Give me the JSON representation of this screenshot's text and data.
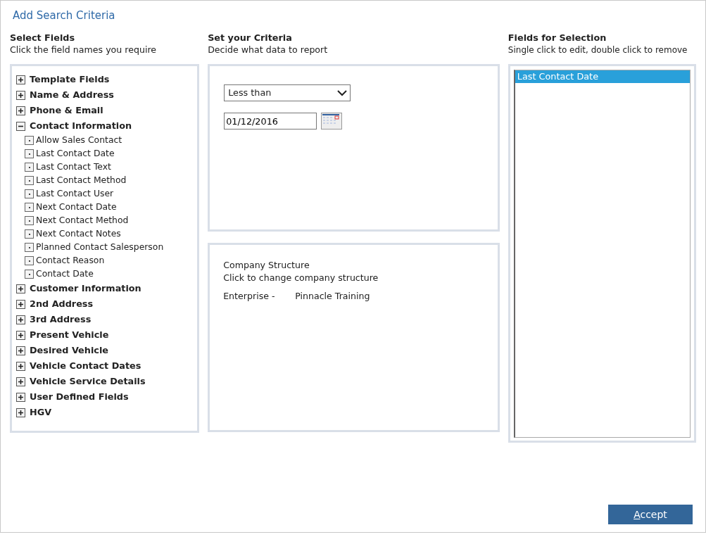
{
  "window": {
    "title": "Add Search Criteria"
  },
  "select_fields": {
    "heading": "Select Fields",
    "subheading": "Click the field names you require",
    "tree": [
      {
        "label": "Template Fields",
        "expanded": false
      },
      {
        "label": "Name & Address",
        "expanded": false
      },
      {
        "label": "Phone & Email",
        "expanded": false
      },
      {
        "label": "Contact Information",
        "expanded": true,
        "children": [
          {
            "label": "Allow Sales Contact"
          },
          {
            "label": "Last Contact Date"
          },
          {
            "label": "Last Contact Text"
          },
          {
            "label": "Last Contact Method"
          },
          {
            "label": "Last Contact User"
          },
          {
            "label": "Next Contact Date"
          },
          {
            "label": "Next Contact Method"
          },
          {
            "label": "Next Contact Notes"
          },
          {
            "label": "Planned Contact Salesperson"
          },
          {
            "label": "Contact Reason"
          },
          {
            "label": "Contact Date"
          }
        ]
      },
      {
        "label": "Customer Information",
        "expanded": false
      },
      {
        "label": "2nd Address",
        "expanded": false
      },
      {
        "label": "3rd Address",
        "expanded": false
      },
      {
        "label": "Present Vehicle",
        "expanded": false
      },
      {
        "label": "Desired Vehicle",
        "expanded": false
      },
      {
        "label": "Vehicle Contact Dates",
        "expanded": false
      },
      {
        "label": "Vehicle Service Details",
        "expanded": false
      },
      {
        "label": "User Defined Fields",
        "expanded": false
      },
      {
        "label": "HGV",
        "expanded": false
      }
    ]
  },
  "criteria": {
    "heading": "Set your Criteria",
    "subheading": "Decide what data to report",
    "operator": "Less than",
    "date": "01/12/2016"
  },
  "company_structure": {
    "title": "Company Structure",
    "hint": "Click to change company structure",
    "label": "Enterprise -",
    "value": "Pinnacle Training"
  },
  "fields_for_selection": {
    "heading": "Fields for Selection",
    "subheading": "Single click to edit, double click to remove",
    "items": [
      {
        "label": "Last Contact Date",
        "selected": true
      }
    ]
  },
  "buttons": [
    {
      "label": "Accept"
    }
  ]
}
